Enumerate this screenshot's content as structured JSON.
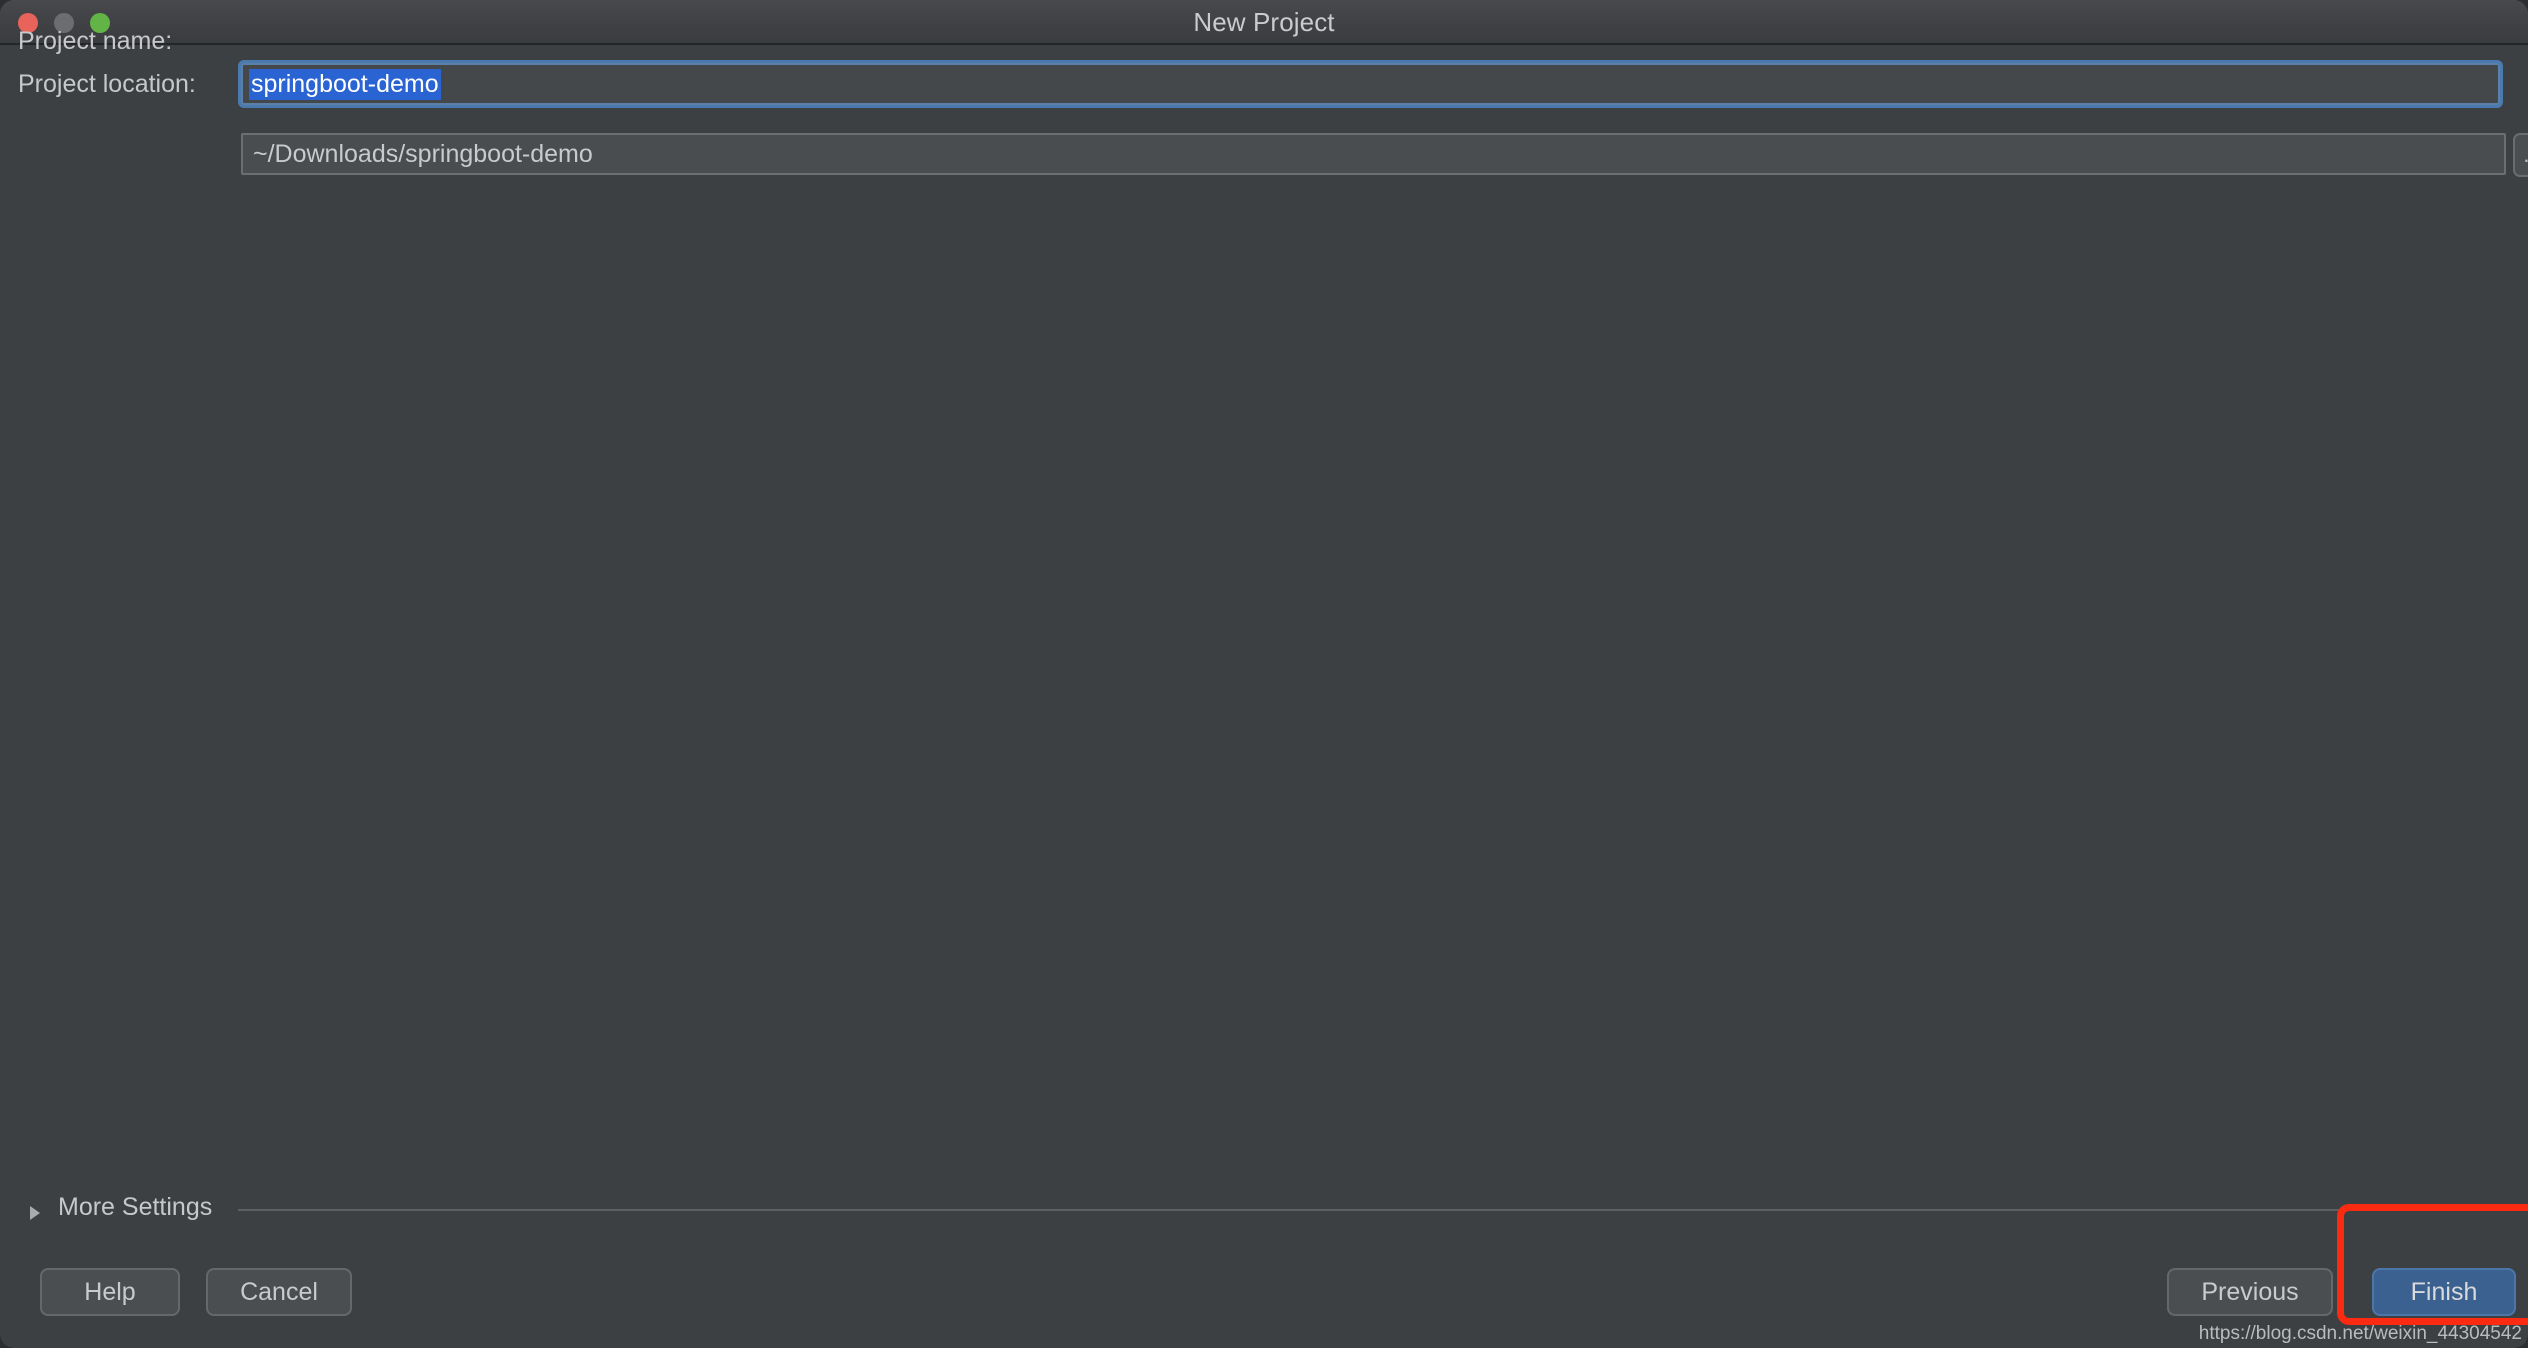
{
  "window": {
    "title": "New Project",
    "traffic_lights": [
      {
        "name": "close",
        "color": "#e8645a"
      },
      {
        "name": "minimize",
        "color": "#6b6d70"
      },
      {
        "name": "maximize",
        "color": "#62b447"
      }
    ]
  },
  "form": {
    "project_name": {
      "label": "Project name:",
      "value": "springboot-demo",
      "selected": true
    },
    "project_location": {
      "label": "Project location:",
      "value": "~/Downloads/springboot-demo",
      "browse_label": "..."
    }
  },
  "more_settings": {
    "label": "More Settings",
    "expanded": false,
    "arrow_icon": "triangle-right-icon"
  },
  "footer": {
    "help_label": "Help",
    "cancel_label": "Cancel",
    "previous_label": "Previous",
    "finish_label": "Finish"
  },
  "annotation": {
    "color": "#fb2b12",
    "target": "finish-button"
  },
  "watermark": {
    "text": "https://blog.csdn.net/weixin_44304542"
  },
  "colors": {
    "background": "#3c4043",
    "titlebar": "#3f4144",
    "accent_primary": "#3b6190",
    "selection": "#2a63d2",
    "focus_ring": "#4a7ab0",
    "annotation_red": "#fb2b12"
  }
}
